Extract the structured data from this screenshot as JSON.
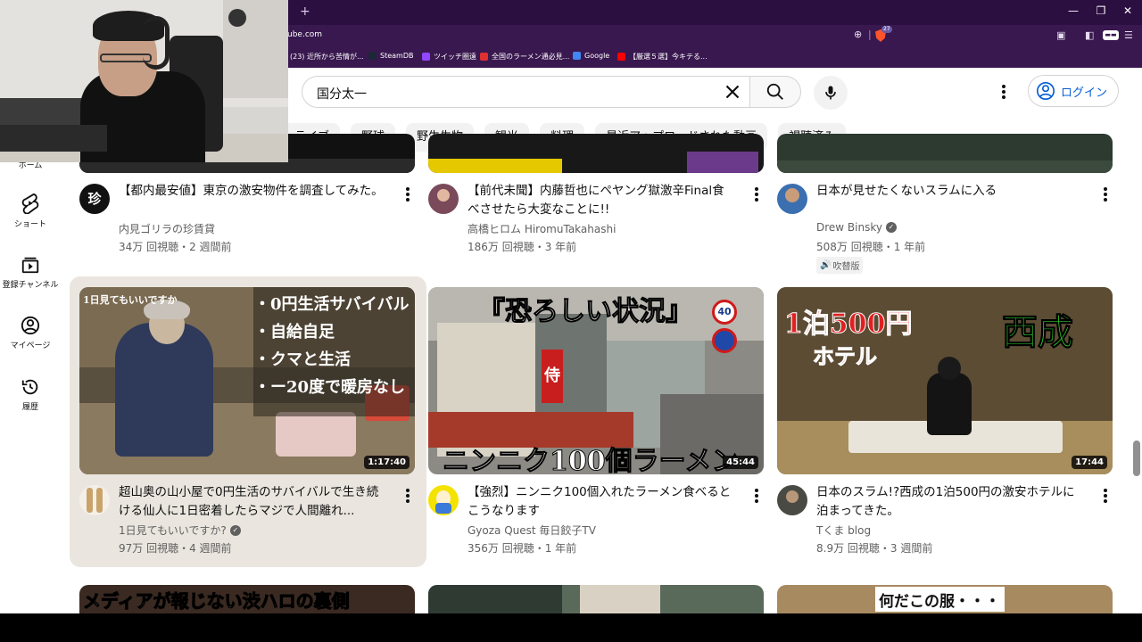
{
  "browser": {
    "url": "ube.com",
    "bookmarks": [
      {
        "label": "(23) 近所から苦情が...",
        "color": "#ff0000"
      },
      {
        "label": "SteamDB",
        "color": "#1b2838"
      },
      {
        "label": "ツイッチ圏遠",
        "color": "#9146ff"
      },
      {
        "label": "全国のラーメン通必見...",
        "color": "#e03030"
      },
      {
        "label": "Google",
        "color": "#4285f4"
      },
      {
        "label": "【厳選５選】今キテる...",
        "color": "#ff0000"
      }
    ],
    "brave_count": "27"
  },
  "search": {
    "query": "国分太一"
  },
  "header": {
    "login_label": "ログイン"
  },
  "chips": [
    "ライブ",
    "野球",
    "野生生物",
    "観光",
    "料理",
    "最近アップロードされた動画",
    "視聴済み"
  ],
  "sidebar": {
    "items": [
      {
        "label": "ホーム",
        "icon": "home-icon"
      },
      {
        "label": "ショート",
        "icon": "shorts-icon"
      },
      {
        "label": "登録チャンネル",
        "icon": "subscriptions-icon"
      },
      {
        "label": "マイページ",
        "icon": "account-icon"
      },
      {
        "label": "履歴",
        "icon": "history-icon"
      }
    ]
  },
  "videos": [
    {
      "title": "【都内最安値】東京の激安物件を調査してみた。",
      "channel": "内見ゴリラの珍賃貸",
      "verified": false,
      "meta": "34万 回視聴・2 週間前",
      "duration": "",
      "badge": ""
    },
    {
      "title": "【前代未聞】内藤哲也にペヤング獄激辛Final食べさせたら大変なことに!!",
      "channel": "高橋ヒロム HiromuTakahashi",
      "verified": false,
      "meta": "186万 回視聴・3 年前",
      "duration": "",
      "badge": ""
    },
    {
      "title": "日本が見せたくないスラムに入る",
      "channel": "Drew Binsky",
      "verified": true,
      "meta": "508万 回視聴・1 年前",
      "duration": "",
      "badge": "吹替版"
    },
    {
      "title": "超山奥の山小屋で0円生活のサバイバルで生き続ける仙人に1日密着したらマジで人間離れ...",
      "channel": "1日見てもいいですか?",
      "verified": true,
      "meta": "97万 回視聴・4 週間前",
      "duration": "1:17:40",
      "badge": ""
    },
    {
      "title": "【強烈】ニンニク100個入れたラーメン食べるとこうなります",
      "channel": "Gyoza Quest 毎日餃子TV",
      "verified": false,
      "meta": "356万 回視聴・1 年前",
      "duration": "45:44",
      "badge": ""
    },
    {
      "title": "日本のスラム!?西成の1泊500円の激安ホテルに泊まってきた。",
      "channel": "Tくま blog",
      "verified": false,
      "meta": "8.9万 回視聴・3 週間前",
      "duration": "17:44",
      "badge": ""
    }
  ],
  "thumb_text": {
    "v4_lines": [
      "・0円生活サバイバル",
      "・自給自足",
      "・クマと生活",
      "・ー20度で暖房なし"
    ],
    "v4_corner": "1日見てもいいですか",
    "v5_top": "『恐ろしい状況』",
    "v5_bottom": "ニンニク100個ラーメン",
    "v5_sign1": "40",
    "v5_sign2": "侍",
    "v6_left": "1泊500円",
    "v6_left2": "ホテル",
    "v6_right": "西成",
    "v7_text": "メディアが報じない渋ハロの裏側",
    "v9_text": "何だこの服・・・",
    "v1_avatar": "珍"
  }
}
